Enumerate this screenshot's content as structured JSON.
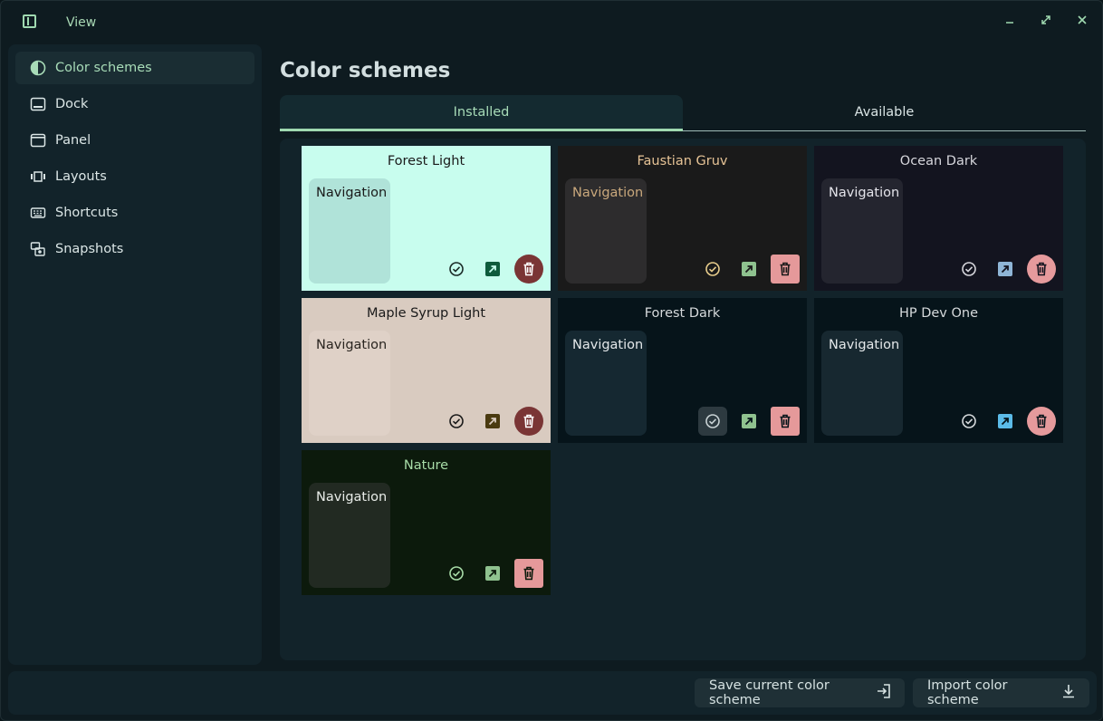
{
  "header": {
    "view_label": "View"
  },
  "sidebar": {
    "items": [
      {
        "label": "Color schemes",
        "icon": "half-circle-icon",
        "active": true
      },
      {
        "label": "Dock",
        "icon": "dock-icon"
      },
      {
        "label": "Panel",
        "icon": "panel-icon"
      },
      {
        "label": "Layouts",
        "icon": "layouts-icon"
      },
      {
        "label": "Shortcuts",
        "icon": "keyboard-icon"
      },
      {
        "label": "Snapshots",
        "icon": "snapshots-icon"
      }
    ]
  },
  "main": {
    "title": "Color schemes",
    "tabs": [
      {
        "label": "Installed",
        "active": true
      },
      {
        "label": "Available"
      }
    ]
  },
  "schemes": [
    {
      "name": "Forest Light",
      "nav_label": "Navigation",
      "colors": {
        "bg": "#c8fdee",
        "nav": "#b0e3d9",
        "title": "#1a1a1a",
        "nav_text": "#1a1a1a",
        "select": "#1a2a26",
        "edit_bg": "#0e5b3c",
        "edit_fg": "#c8fdee",
        "delete_bg": "#7a3535",
        "delete_fg": "#ffffff",
        "delete_round": true
      }
    },
    {
      "name": "Faustian Gruv",
      "nav_label": "Navigation",
      "colors": {
        "bg": "#1a1a1a",
        "nav": "#2d2c2d",
        "title": "#e6c396",
        "nav_text": "#c9a87c",
        "select": "#e8cd8c",
        "edit_bg": "#8fc28f",
        "edit_fg": "#1a1a1a",
        "delete_bg": "#e5999a",
        "delete_fg": "#1a1a1a",
        "delete_round": false
      }
    },
    {
      "name": "Ocean Dark",
      "nav_label": "Navigation",
      "colors": {
        "bg": "#13141f",
        "nav": "#24252f",
        "title": "#d6d6dc",
        "nav_text": "#e4e4ea",
        "select": "#d6d6dc",
        "edit_bg": "#8fb5d6",
        "edit_fg": "#13141f",
        "delete_bg": "#e69a9c",
        "delete_fg": "#13141f",
        "delete_round": true
      }
    },
    {
      "name": "Maple Syrup Light",
      "nav_label": "Navigation",
      "colors": {
        "bg": "#d9cbc0",
        "nav": "#dfd1c7",
        "title": "#1a1a1a",
        "nav_text": "#2a2520",
        "select": "#1a1a1a",
        "edit_bg": "#4a3a10",
        "edit_fg": "#d9cbc0",
        "delete_bg": "#7a3535",
        "delete_fg": "#ffffff",
        "delete_round": true
      }
    },
    {
      "name": "Forest Dark",
      "nav_label": "Navigation",
      "colors": {
        "bg": "#06141a",
        "nav": "#152831",
        "title": "#d6dadc",
        "nav_text": "#e4e8ea",
        "select": "#c8d2d4",
        "select_bg": "#2d3a40",
        "edit_bg": "#8fc28f",
        "edit_fg": "#06141a",
        "delete_bg": "#e5999a",
        "delete_fg": "#06141a",
        "delete_round": false
      }
    },
    {
      "name": "HP Dev One",
      "nav_label": "Navigation",
      "colors": {
        "bg": "#06141a",
        "nav": "#172830",
        "title": "#d6dadc",
        "nav_text": "#e4e8ea",
        "select": "#d6dadc",
        "edit_bg": "#5bbbe8",
        "edit_fg": "#06141a",
        "delete_bg": "#e59a9c",
        "delete_fg": "#06141a",
        "delete_round": true
      }
    },
    {
      "name": "Nature",
      "nav_label": "Navigation",
      "colors": {
        "bg": "#0c1a0c",
        "nav": "#222a22",
        "title": "#a8dca8",
        "nav_text": "#e8ece8",
        "select": "#a8dca8",
        "edit_bg": "#8fc28f",
        "edit_fg": "#0c1a0c",
        "delete_bg": "#e5999a",
        "delete_fg": "#0c1a0c",
        "delete_round": false
      }
    }
  ],
  "footer": {
    "save_label": "Save current color scheme",
    "import_label": "Import color scheme"
  },
  "icons": {
    "app": "app-logo-icon",
    "minimize": "minimize-icon",
    "maximize": "maximize-icon",
    "close": "close-icon",
    "select": "check-circle-icon",
    "edit": "arrow-up-right-icon",
    "delete": "trash-icon",
    "save": "sign-in-icon",
    "import": "download-icon"
  }
}
